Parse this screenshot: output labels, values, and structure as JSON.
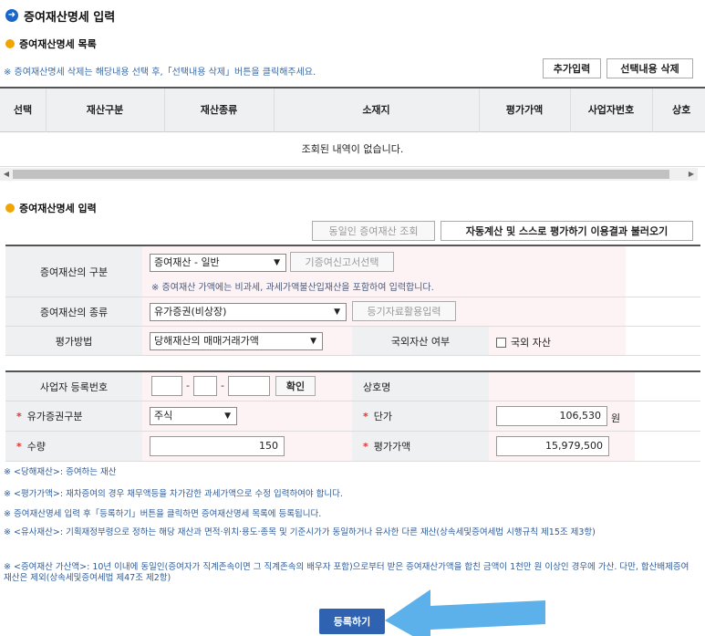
{
  "main_title": "증여재산명세 입력",
  "list_section": {
    "title": "증여재산명세 목록",
    "note": "※ 증여재산명세 삭제는 해당내용 선택 후,「선택내용 삭제」버튼을 클릭해주세요.",
    "add_button": "추가입력",
    "delete_button": "선택내용 삭제",
    "columns": [
      "선택",
      "재산구분",
      "재산종류",
      "소재지",
      "평가가액",
      "사업자번호",
      "상호"
    ],
    "empty_message": "조회된 내역이 없습니다."
  },
  "input_section": {
    "title": "증여재산명세 입력",
    "query_button": "동일인 증여재산 조회",
    "autocalc_button": "자동계산 및 스스로 평가하기 이용결과 불러오기",
    "asset_category": {
      "label": "증여재산의 구분",
      "value": "증여재산 - 일반",
      "side_button": "기증여신고서선택",
      "hint": "※ 증여재산 가액에는 비과세, 과세가액불산입재산을 포함하여 입력합니다."
    },
    "asset_type": {
      "label": "증여재산의 종류",
      "value": "유가증권(비상장)",
      "side_button": "등기자료활용입력"
    },
    "valuation_method": {
      "label": "평가방법",
      "value": "당해재산의 매매거래가액"
    },
    "foreign_asset": {
      "label": "국외자산 여부",
      "checkbox_label": "국외 자산"
    },
    "business_number": {
      "label": "사업자 등록번호",
      "confirm_button": "확인"
    },
    "company_name": {
      "label": "상호명"
    },
    "security_type": {
      "label": "유가증권구분",
      "value": "주식"
    },
    "unit_price": {
      "label": "단가",
      "value": "106,530",
      "unit": "원"
    },
    "quantity": {
      "label": "수량",
      "value": "150"
    },
    "appraised_value": {
      "label": "평가가액",
      "value": "15,979,500"
    },
    "required_mark": "*"
  },
  "notes": [
    "※ <당해재산>: 증여하는 재산",
    "※ <평가가액>: 재차증여의 경우 채무액등을 차가감한 과세가액으로 수정 입력하여야 합니다.",
    "※ 증여재산명세 입력 후「등록하기」버튼을 클릭하면 증여재산명세 목록에 등록됩니다.",
    "※ <유사재산>: 기획재정부령으로 정하는 해당 재산과 면적·위치·용도·종목 및 기준시가가 동일하거나 유사한 다른 재산(상속세및증여세법 시행규칙 제15조 제3항)",
    "※ <증여재산 가산액>: 10년 이내에 동일인(증여자가 직계존속이면 그 직계존속의 배우자 포함)으로부터 받은 증여재산가액을 합친 금액이 1천만 원 이상인 경우에 가산. 다만, 합산배제증여재산은 제외(상속세및증여세법 제47조 제2항)"
  ],
  "register_button": "등록하기",
  "colors": {
    "accent_blue": "#2f62b0",
    "note_blue": "#2f5c98",
    "header_gray": "#eef0f2",
    "required_red": "#d33333",
    "arrow_blue": "#4aa8e8"
  }
}
